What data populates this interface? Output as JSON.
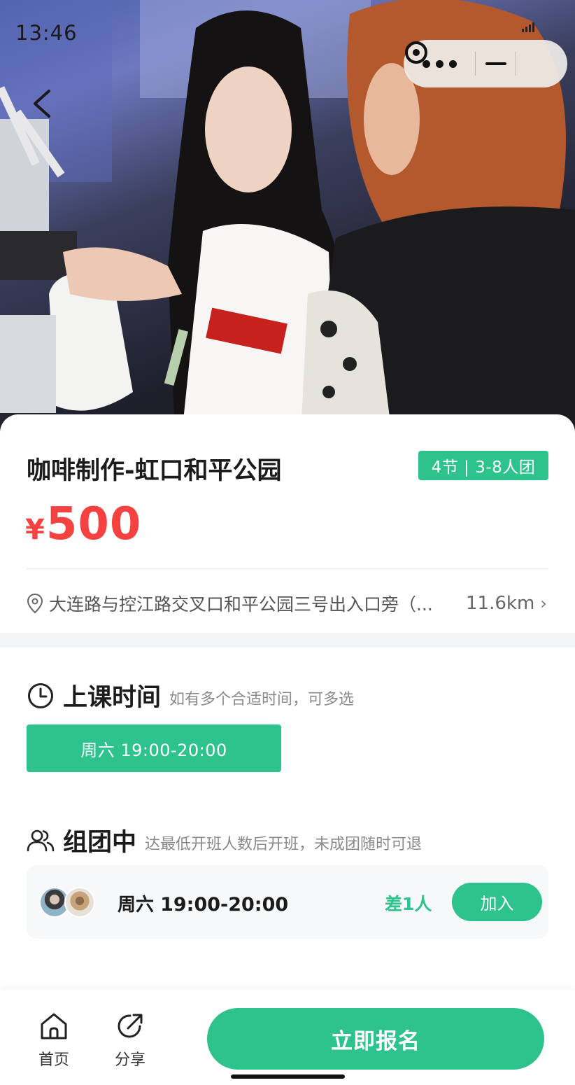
{
  "status_bar": {
    "time": "13:46"
  },
  "hero": {},
  "course": {
    "title": "咖啡制作-虹口和平公园",
    "tag": "4节 | 3-8人团",
    "price_currency": "¥",
    "price_amount": "500",
    "address": "大连路与控江路交叉口和平公园三号出入口旁（...",
    "distance": "11.6km",
    "distance_chevron": "›"
  },
  "schedule": {
    "heading": "上课时间",
    "subtitle": "如有多个合适时间，可多选",
    "options": [
      "周六 19:00-20:00"
    ]
  },
  "grouping": {
    "heading": "组团中",
    "subtitle": "达最低开班人数后开班，未成团随时可退",
    "group": {
      "day": "周六",
      "time": "19:00-20:00",
      "short": "差1人",
      "join_label": "加入"
    }
  },
  "bottom_bar": {
    "home_label": "首页",
    "share_label": "分享",
    "signup_label": "立即报名"
  },
  "colors": {
    "accent": "#2ec28c",
    "price": "#f5413f"
  }
}
